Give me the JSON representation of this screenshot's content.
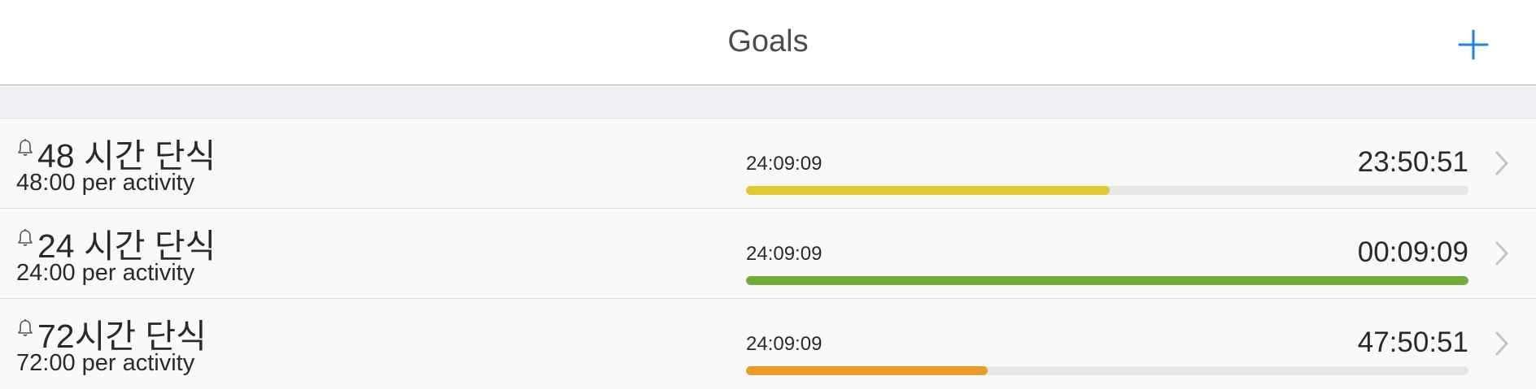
{
  "navbar": {
    "title": "Goals",
    "add_icon": "plus-icon",
    "accent_color": "#1a82f0"
  },
  "goals": [
    {
      "name": "48 시간 단식",
      "subtitle": "48:00 per activity",
      "elapsed": "24:09:09",
      "remaining": "23:50:51",
      "progress": 0.503,
      "color": "#dfcb2f",
      "bell_icon": "bell-icon",
      "chevron_icon": "chevron-right-icon"
    },
    {
      "name": "24 시간 단식",
      "subtitle": "24:00 per activity",
      "elapsed": "24:09:09",
      "remaining": "00:09:09",
      "progress": 1.0,
      "color": "#72ad37",
      "bell_icon": "bell-icon",
      "chevron_icon": "chevron-right-icon"
    },
    {
      "name": "72시간 단식",
      "subtitle": "72:00 per activity",
      "elapsed": "24:09:09",
      "remaining": "47:50:51",
      "progress": 0.335,
      "color": "#eb9c25",
      "bell_icon": "bell-icon",
      "chevron_icon": "chevron-right-icon"
    }
  ]
}
